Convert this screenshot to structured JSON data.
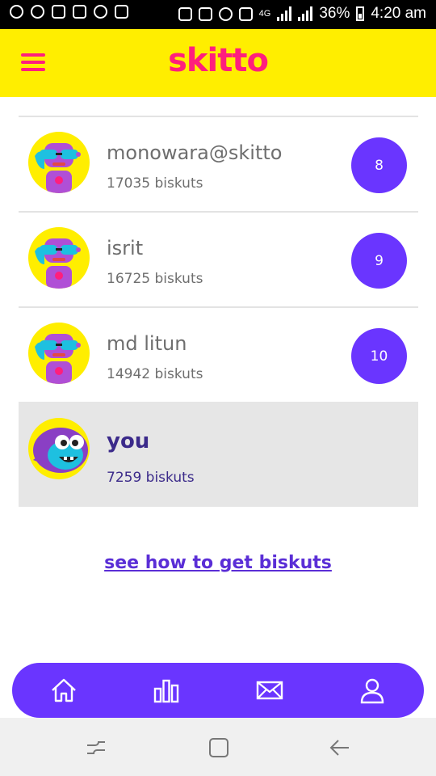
{
  "status_bar": {
    "network": "4G",
    "battery": "36%",
    "time": "4:20 am"
  },
  "header": {
    "logo": "skitto"
  },
  "leaderboard": [
    {
      "name": "monowara@skitto",
      "score": "17035 biskuts",
      "rank": "8"
    },
    {
      "name": "isrit",
      "score": "16725 biskuts",
      "rank": "9"
    },
    {
      "name": "md litun",
      "score": "14942 biskuts",
      "rank": "10"
    }
  ],
  "you": {
    "name": "you",
    "score": "7259 biskuts"
  },
  "link": {
    "label": "see how to get biskuts"
  },
  "colors": {
    "accent": "#6a35ff",
    "brand": "#ff1f7d",
    "header_bg": "#ffee00"
  },
  "bottom_nav": {
    "items": [
      "home-icon",
      "chart-icon",
      "mail-icon",
      "profile-icon"
    ]
  }
}
